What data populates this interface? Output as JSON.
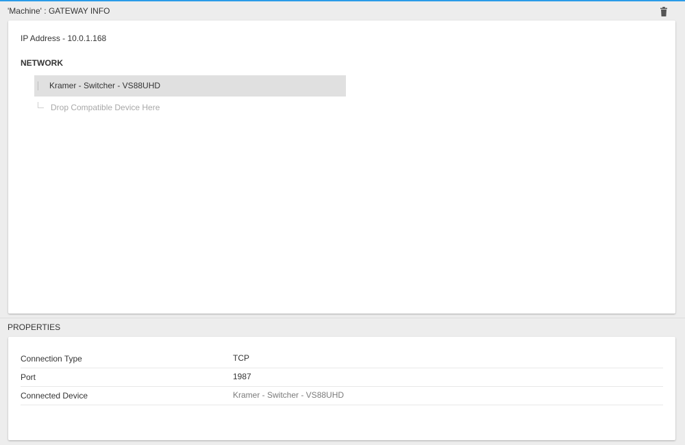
{
  "gateway": {
    "header_title": "'Machine' : GATEWAY INFO",
    "delete_icon": "trash-icon",
    "ip_address": "IP Address - 10.0.1.168",
    "network_heading": "NETWORK",
    "devices": [
      {
        "label": "Kramer - Switcher - VS88UHD"
      }
    ],
    "drop_placeholder": "Drop Compatible Device Here"
  },
  "properties": {
    "header_title": "PROPERTIES",
    "rows": [
      {
        "key": "Connection Type",
        "value": "TCP"
      },
      {
        "key": "Port",
        "value": "1987"
      },
      {
        "key": "Connected Device",
        "value": "Kramer - Switcher - VS88UHD"
      }
    ]
  },
  "colors": {
    "accent": "#2a9be8",
    "selected_row": "#e0e0e0",
    "panel_background": "#ededed"
  }
}
